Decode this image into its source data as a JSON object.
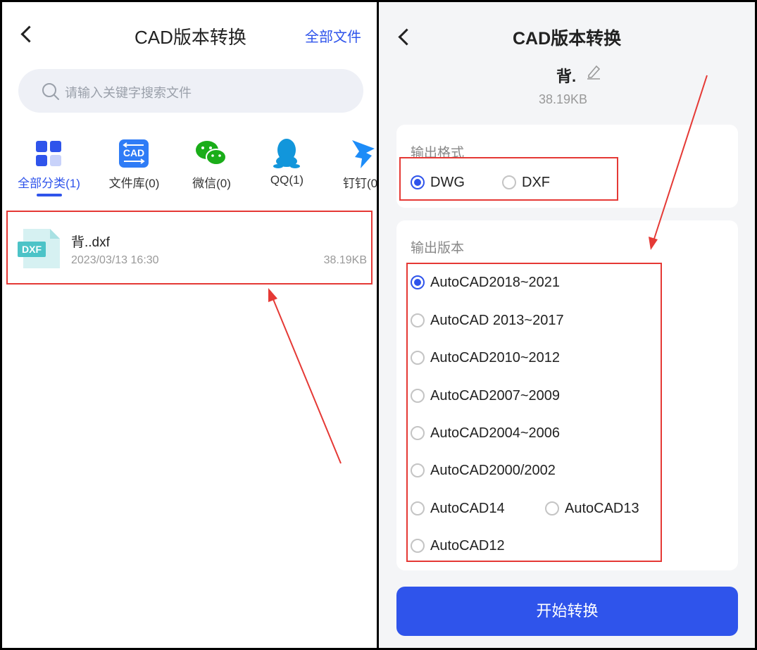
{
  "left": {
    "header": {
      "title": "CAD版本转换",
      "right_link": "全部文件"
    },
    "search": {
      "placeholder": "请输入关键字搜索文件",
      "icon": "search-icon"
    },
    "categories": [
      {
        "label": "全部分类(1)",
        "icon": "grid-icon",
        "active": true
      },
      {
        "label": "文件库(0)",
        "icon": "cad-library-icon",
        "active": false
      },
      {
        "label": "微信(0)",
        "icon": "wechat-icon",
        "active": false
      },
      {
        "label": "QQ(1)",
        "icon": "qq-icon",
        "active": false
      },
      {
        "label": "钉钉(0",
        "icon": "dingtalk-icon",
        "active": false
      }
    ],
    "file": {
      "name": "背..dxf",
      "date": "2023/03/13  16:30",
      "size": "38.19KB",
      "type_badge": "DXF"
    }
  },
  "right": {
    "header": {
      "title": "CAD版本转换"
    },
    "file": {
      "name": "背.",
      "size": "38.19KB"
    },
    "format": {
      "title": "输出格式",
      "options": [
        {
          "label": "DWG",
          "checked": true
        },
        {
          "label": "DXF",
          "checked": false
        }
      ]
    },
    "version": {
      "title": "输出版本",
      "options": [
        {
          "label": "AutoCAD2018~2021",
          "checked": true
        },
        {
          "label": "AutoCAD 2013~2017",
          "checked": false
        },
        {
          "label": "AutoCAD2010~2012",
          "checked": false
        },
        {
          "label": "AutoCAD2007~2009",
          "checked": false
        },
        {
          "label": "AutoCAD2004~2006",
          "checked": false
        },
        {
          "label": "AutoCAD2000/2002",
          "checked": false
        },
        {
          "label": "AutoCAD14",
          "checked": false
        },
        {
          "label": "AutoCAD13",
          "checked": false
        },
        {
          "label": "AutoCAD12",
          "checked": false
        }
      ]
    },
    "start_button": "开始转换"
  },
  "colors": {
    "accent": "#2f54eb",
    "annotation_red": "#e53935",
    "dxf_teal": "#4cc3c7"
  }
}
